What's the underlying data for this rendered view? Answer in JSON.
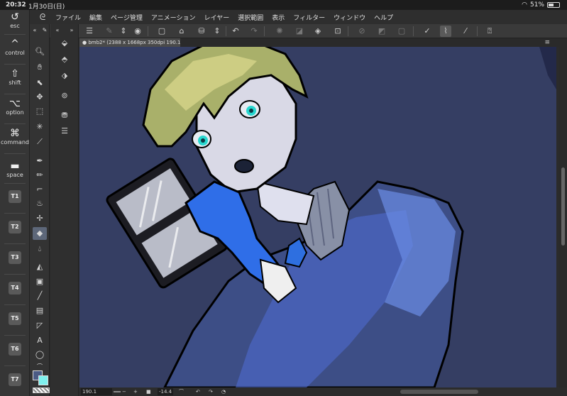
{
  "status_bar": {
    "time": "20:32",
    "date": "1月30日(日)",
    "battery_text": "51%",
    "battery_level": 0.51
  },
  "edge_keys": [
    {
      "label": "esc",
      "icon": "undo-arrow-icon"
    },
    {
      "label": "control",
      "icon": "caret-up-icon"
    },
    {
      "label": "shift",
      "icon": "shift-arrow-icon"
    },
    {
      "label": "option",
      "icon": "option-key-icon"
    },
    {
      "label": "command",
      "icon": "command-key-icon"
    },
    {
      "label": "space",
      "icon": "space-bar-icon"
    },
    {
      "label": "T1"
    },
    {
      "label": "T2"
    },
    {
      "label": "T3"
    },
    {
      "label": "T4"
    },
    {
      "label": "T5"
    },
    {
      "label": "T6"
    },
    {
      "label": "T7"
    }
  ],
  "menu": {
    "items": [
      "ファイル",
      "編集",
      "ページ管理",
      "アニメーション",
      "レイヤー",
      "選択範囲",
      "表示",
      "フィルター",
      "ウィンドウ",
      "ヘルプ"
    ]
  },
  "document_tab": {
    "title": "bmb2* (2388 x 1668px 350dpi 190.1%)"
  },
  "navigator": {
    "zoom": "190.1",
    "angle": "-14.4"
  },
  "colors": {
    "main_color": "#4b5b84",
    "sub_color": "#7ff0ee",
    "canvas_bg": "#353e63",
    "active_tool": "#5d6779"
  },
  "tools": [
    "zoom-icon",
    "hand-icon",
    "object-icon",
    "move-icon",
    "selection-icon",
    "auto-select-icon",
    "eyedropper-icon",
    "pen-icon",
    "pencil-icon",
    "brush-icon",
    "airbrush-icon",
    "decoration-icon",
    "eraser-icon",
    "blend-icon",
    "fill-icon",
    "gradient-icon",
    "figure-icon",
    "frame-icon",
    "ruler-icon",
    "text-icon",
    "balloon-icon",
    "line-correction-icon"
  ]
}
